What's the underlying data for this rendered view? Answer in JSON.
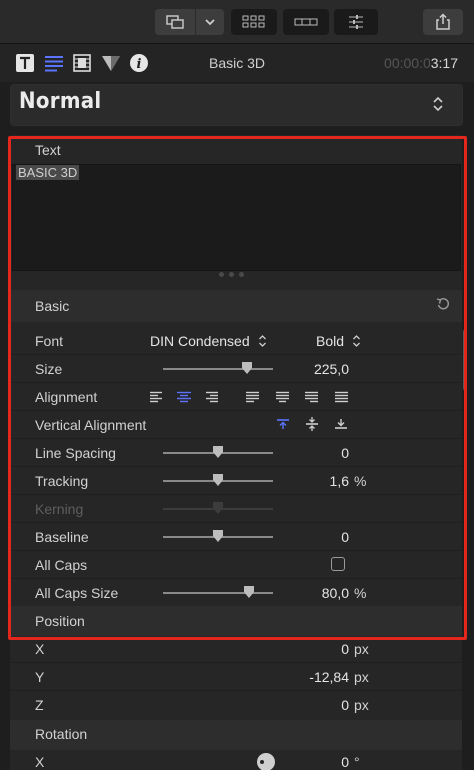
{
  "toolbar": {
    "buttons": [
      "layout-icon",
      "chevron-down-icon",
      "grid-view-icon",
      "filmstrip-view-icon",
      "sliders-icon",
      "share-icon"
    ]
  },
  "inspector": {
    "tabs": [
      "text-tab-icon",
      "paragraph-tab-icon",
      "video-tab-icon",
      "color-tab-icon",
      "info-tab-icon"
    ],
    "title": "Basic 3D",
    "timecode_dim": "00:00:0",
    "timecode_bright": "3:17"
  },
  "preset": {
    "label": "Normal"
  },
  "text_section": {
    "heading": "Text",
    "content": "BASIC 3D"
  },
  "basic_section": {
    "heading": "Basic",
    "rows": {
      "font": {
        "label": "Font",
        "family": "DIN Condensed",
        "style": "Bold"
      },
      "size": {
        "label": "Size",
        "value": "225,0"
      },
      "alignment": {
        "label": "Alignment"
      },
      "vertical_alignment": {
        "label": "Vertical Alignment"
      },
      "line_spacing": {
        "label": "Line Spacing",
        "value": "0"
      },
      "tracking": {
        "label": "Tracking",
        "value": "1,6",
        "unit": "%"
      },
      "kerning": {
        "label": "Kerning"
      },
      "baseline": {
        "label": "Baseline",
        "value": "0"
      },
      "all_caps": {
        "label": "All Caps",
        "checked": false
      },
      "all_caps_size": {
        "label": "All Caps Size",
        "value": "80,0",
        "unit": "%"
      }
    }
  },
  "position_section": {
    "heading": "Position",
    "x": {
      "label": "X",
      "value": "0",
      "unit": "px"
    },
    "y": {
      "label": "Y",
      "value": "-12,84",
      "unit": "px"
    },
    "z": {
      "label": "Z",
      "value": "0",
      "unit": "px"
    }
  },
  "rotation_section": {
    "heading": "Rotation",
    "x": {
      "label": "X",
      "value": "0",
      "unit": "°"
    }
  },
  "colors": {
    "highlight": "#e3271d",
    "accent": "#5b74ff"
  }
}
